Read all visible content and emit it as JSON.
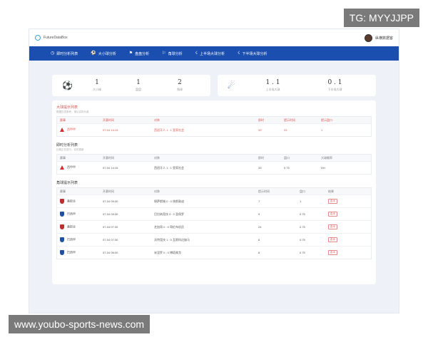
{
  "brand": {
    "name": "FutureDataBox"
  },
  "user": {
    "name": "纵横数据客"
  },
  "nav": [
    {
      "icon": "clock-icon",
      "glyph": "◷",
      "label": "即时分析列表"
    },
    {
      "icon": "ball-icon",
      "glyph": "⚽",
      "label": "大小球分析"
    },
    {
      "icon": "goal-icon",
      "glyph": "⚑",
      "label": "盘盘分析"
    },
    {
      "icon": "corner-icon",
      "glyph": "⚐",
      "label": "角球分析"
    },
    {
      "icon": "first-half-icon",
      "glyph": "☇",
      "label": "上半场大球分析"
    },
    {
      "icon": "second-half-icon",
      "glyph": "☇",
      "label": "下半场大球分析"
    }
  ],
  "stats_left": [
    {
      "value": "1",
      "label": "大小球"
    },
    {
      "value": "1",
      "label": "盘盘"
    },
    {
      "value": "2",
      "label": "角球"
    }
  ],
  "stats_right": [
    {
      "value": "1 . 1",
      "label": "上半场大球"
    },
    {
      "value": "0 . 1",
      "label": "下半场大球"
    }
  ],
  "sections": {
    "big": {
      "title": "大球提示列表",
      "subtitle": "数据仅供参考，请以实际为准",
      "headers": [
        "赛事",
        "开赛时间",
        "对阵",
        "即时",
        "提示时间",
        "提示盘口"
      ],
      "rows": [
        {
          "league": "西甲甲",
          "time": "07-04 14:15",
          "match": "西班牙人  1 : 1  皇家社会",
          "live": "33'",
          "hint_time": "33",
          "line": "1"
        }
      ]
    },
    "instant": {
      "title": "即时分析列表",
      "subtitle": "比赛正在进行，实时更新",
      "headers": [
        "赛事",
        "开赛时间",
        "对阵",
        "即时",
        "盘口",
        "大球概率"
      ],
      "rows": [
        {
          "league": "西甲甲",
          "time": "07-04 14:15",
          "match": "西班牙人  1 : 1  皇家社会",
          "live": "33'",
          "line": "0.75",
          "rate": "DH"
        }
      ]
    },
    "corner": {
      "title": "角球提示列表",
      "headers": [
        "赛事",
        "开赛时间",
        "对阵",
        "提示时间",
        "盘口",
        "结果"
      ],
      "rows": [
        {
          "league": "美职业",
          "team_icon": "red-shield",
          "time": "07-04 09:30",
          "match": "堪萨斯城  0 : 0  休斯敦迪",
          "hint": "7",
          "line": "1",
          "result": "走水"
        },
        {
          "league": "巴西甲",
          "team_icon": "blue-shield",
          "time": "07-04 09:30",
          "match": "巴拉纳竞技  0 : 0  圣保罗",
          "hint": "9",
          "line": "0.75",
          "result": "走水"
        },
        {
          "league": "美职业",
          "team_icon": "red-shield",
          "time": "07-04 07:30",
          "match": "芝加哥  0 : 0  哥伦布机员",
          "hint": "24",
          "line": "0.75",
          "result": "走水"
        },
        {
          "league": "巴西甲",
          "team_icon": "blue-shield",
          "time": "07-04 07:30",
          "match": "沃特竞技  1 : 0  瓦斯科达伽马",
          "hint": "8",
          "line": "0.75",
          "result": "走水"
        },
        {
          "league": "巴西甲",
          "team_icon": "blue-shield",
          "time": "07-04 06:00",
          "match": "米涅罗  0 : 0  博塔弗戈",
          "hint": "8",
          "line": "0.75",
          "result": "走水"
        }
      ]
    }
  },
  "watermarks": {
    "tg": "TG: MYYJJPP",
    "url": "www.youbo-sports-news.com"
  }
}
